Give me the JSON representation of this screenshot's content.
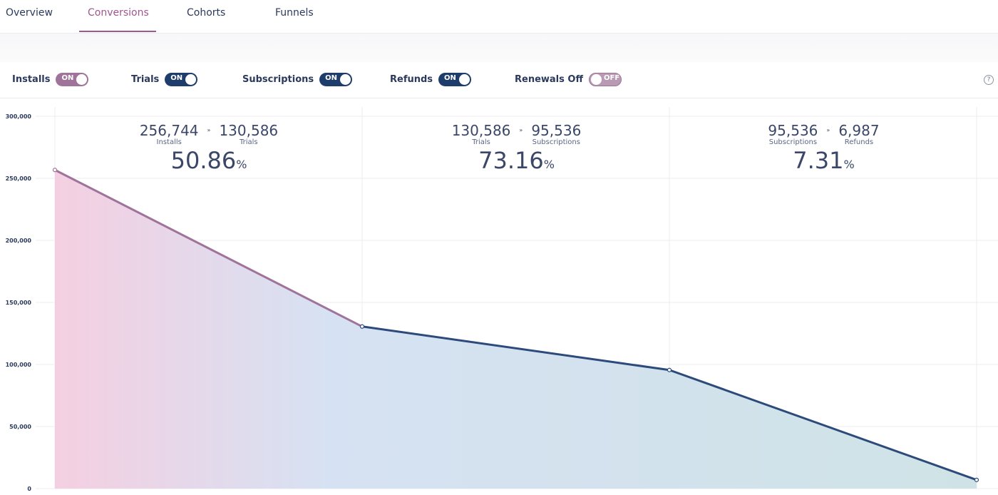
{
  "tabs": [
    {
      "label": "Overview",
      "active": false
    },
    {
      "label": "Conversions",
      "active": true
    },
    {
      "label": "Cohorts",
      "active": false
    },
    {
      "label": "Funnels",
      "active": false
    }
  ],
  "toggles": [
    {
      "label": "Installs",
      "state": "ON",
      "color": "#a0739a"
    },
    {
      "label": "Trials",
      "state": "ON",
      "color": "#1e3d6b"
    },
    {
      "label": "Subscriptions",
      "state": "ON",
      "color": "#1e3d6b"
    },
    {
      "label": "Refunds",
      "state": "ON",
      "color": "#1e3d6b"
    },
    {
      "label": "Renewals Off",
      "state": "OFF",
      "color": "#b99ab4"
    }
  ],
  "help_icon": "question-circle-icon",
  "stages": [
    {
      "from_value": "256,744",
      "from_label": "Installs",
      "to_value": "130,586",
      "to_label": "Trials",
      "rate": "50.86",
      "unit": "%"
    },
    {
      "from_value": "130,586",
      "from_label": "Trials",
      "to_value": "95,536",
      "to_label": "Subscriptions",
      "rate": "73.16",
      "unit": "%"
    },
    {
      "from_value": "95,536",
      "from_label": "Subscriptions",
      "to_value": "6,987",
      "to_label": "Refunds",
      "rate": "7.31",
      "unit": "%"
    }
  ],
  "arrow_glyph": "»",
  "chart_data": {
    "type": "area",
    "categories": [
      "Installs",
      "Trials",
      "Subscriptions",
      "Refunds"
    ],
    "values": [
      256744,
      130586,
      95536,
      6987
    ],
    "ylim": [
      0,
      300000
    ],
    "yticks": [
      "0",
      "50,000",
      "100,000",
      "150,000",
      "200,000",
      "250,000",
      "300,000"
    ],
    "ytick_values": [
      0,
      50000,
      100000,
      150000,
      200000,
      250000,
      300000
    ],
    "grid": true,
    "colors": {
      "line": "#2c4a7a",
      "line_start": "#a0739a",
      "fill_start": "#f4cfe1",
      "fill_mid": "#d6e2f3",
      "fill_end": "#cfe3e6"
    }
  }
}
